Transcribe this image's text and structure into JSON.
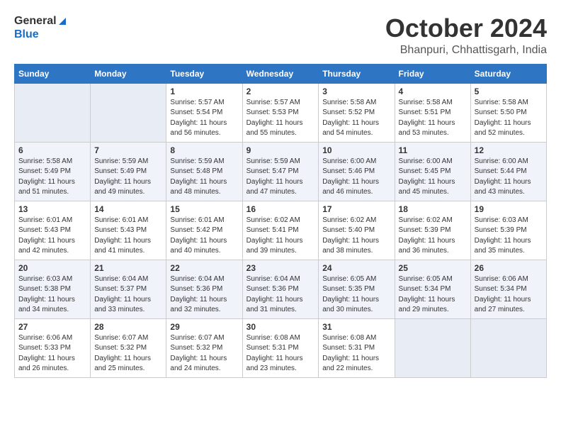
{
  "logo": {
    "general": "General",
    "blue": "Blue"
  },
  "title": "October 2024",
  "location": "Bhanpuri, Chhattisgarh, India",
  "days_of_week": [
    "Sunday",
    "Monday",
    "Tuesday",
    "Wednesday",
    "Thursday",
    "Friday",
    "Saturday"
  ],
  "weeks": [
    [
      {
        "day": "",
        "sunrise": "",
        "sunset": "",
        "daylight": "",
        "empty": true
      },
      {
        "day": "",
        "sunrise": "",
        "sunset": "",
        "daylight": "",
        "empty": true
      },
      {
        "day": "1",
        "sunrise": "Sunrise: 5:57 AM",
        "sunset": "Sunset: 5:54 PM",
        "daylight": "Daylight: 11 hours and 56 minutes.",
        "empty": false
      },
      {
        "day": "2",
        "sunrise": "Sunrise: 5:57 AM",
        "sunset": "Sunset: 5:53 PM",
        "daylight": "Daylight: 11 hours and 55 minutes.",
        "empty": false
      },
      {
        "day": "3",
        "sunrise": "Sunrise: 5:58 AM",
        "sunset": "Sunset: 5:52 PM",
        "daylight": "Daylight: 11 hours and 54 minutes.",
        "empty": false
      },
      {
        "day": "4",
        "sunrise": "Sunrise: 5:58 AM",
        "sunset": "Sunset: 5:51 PM",
        "daylight": "Daylight: 11 hours and 53 minutes.",
        "empty": false
      },
      {
        "day": "5",
        "sunrise": "Sunrise: 5:58 AM",
        "sunset": "Sunset: 5:50 PM",
        "daylight": "Daylight: 11 hours and 52 minutes.",
        "empty": false
      }
    ],
    [
      {
        "day": "6",
        "sunrise": "Sunrise: 5:58 AM",
        "sunset": "Sunset: 5:49 PM",
        "daylight": "Daylight: 11 hours and 51 minutes.",
        "empty": false
      },
      {
        "day": "7",
        "sunrise": "Sunrise: 5:59 AM",
        "sunset": "Sunset: 5:49 PM",
        "daylight": "Daylight: 11 hours and 49 minutes.",
        "empty": false
      },
      {
        "day": "8",
        "sunrise": "Sunrise: 5:59 AM",
        "sunset": "Sunset: 5:48 PM",
        "daylight": "Daylight: 11 hours and 48 minutes.",
        "empty": false
      },
      {
        "day": "9",
        "sunrise": "Sunrise: 5:59 AM",
        "sunset": "Sunset: 5:47 PM",
        "daylight": "Daylight: 11 hours and 47 minutes.",
        "empty": false
      },
      {
        "day": "10",
        "sunrise": "Sunrise: 6:00 AM",
        "sunset": "Sunset: 5:46 PM",
        "daylight": "Daylight: 11 hours and 46 minutes.",
        "empty": false
      },
      {
        "day": "11",
        "sunrise": "Sunrise: 6:00 AM",
        "sunset": "Sunset: 5:45 PM",
        "daylight": "Daylight: 11 hours and 45 minutes.",
        "empty": false
      },
      {
        "day": "12",
        "sunrise": "Sunrise: 6:00 AM",
        "sunset": "Sunset: 5:44 PM",
        "daylight": "Daylight: 11 hours and 43 minutes.",
        "empty": false
      }
    ],
    [
      {
        "day": "13",
        "sunrise": "Sunrise: 6:01 AM",
        "sunset": "Sunset: 5:43 PM",
        "daylight": "Daylight: 11 hours and 42 minutes.",
        "empty": false
      },
      {
        "day": "14",
        "sunrise": "Sunrise: 6:01 AM",
        "sunset": "Sunset: 5:43 PM",
        "daylight": "Daylight: 11 hours and 41 minutes.",
        "empty": false
      },
      {
        "day": "15",
        "sunrise": "Sunrise: 6:01 AM",
        "sunset": "Sunset: 5:42 PM",
        "daylight": "Daylight: 11 hours and 40 minutes.",
        "empty": false
      },
      {
        "day": "16",
        "sunrise": "Sunrise: 6:02 AM",
        "sunset": "Sunset: 5:41 PM",
        "daylight": "Daylight: 11 hours and 39 minutes.",
        "empty": false
      },
      {
        "day": "17",
        "sunrise": "Sunrise: 6:02 AM",
        "sunset": "Sunset: 5:40 PM",
        "daylight": "Daylight: 11 hours and 38 minutes.",
        "empty": false
      },
      {
        "day": "18",
        "sunrise": "Sunrise: 6:02 AM",
        "sunset": "Sunset: 5:39 PM",
        "daylight": "Daylight: 11 hours and 36 minutes.",
        "empty": false
      },
      {
        "day": "19",
        "sunrise": "Sunrise: 6:03 AM",
        "sunset": "Sunset: 5:39 PM",
        "daylight": "Daylight: 11 hours and 35 minutes.",
        "empty": false
      }
    ],
    [
      {
        "day": "20",
        "sunrise": "Sunrise: 6:03 AM",
        "sunset": "Sunset: 5:38 PM",
        "daylight": "Daylight: 11 hours and 34 minutes.",
        "empty": false
      },
      {
        "day": "21",
        "sunrise": "Sunrise: 6:04 AM",
        "sunset": "Sunset: 5:37 PM",
        "daylight": "Daylight: 11 hours and 33 minutes.",
        "empty": false
      },
      {
        "day": "22",
        "sunrise": "Sunrise: 6:04 AM",
        "sunset": "Sunset: 5:36 PM",
        "daylight": "Daylight: 11 hours and 32 minutes.",
        "empty": false
      },
      {
        "day": "23",
        "sunrise": "Sunrise: 6:04 AM",
        "sunset": "Sunset: 5:36 PM",
        "daylight": "Daylight: 11 hours and 31 minutes.",
        "empty": false
      },
      {
        "day": "24",
        "sunrise": "Sunrise: 6:05 AM",
        "sunset": "Sunset: 5:35 PM",
        "daylight": "Daylight: 11 hours and 30 minutes.",
        "empty": false
      },
      {
        "day": "25",
        "sunrise": "Sunrise: 6:05 AM",
        "sunset": "Sunset: 5:34 PM",
        "daylight": "Daylight: 11 hours and 29 minutes.",
        "empty": false
      },
      {
        "day": "26",
        "sunrise": "Sunrise: 6:06 AM",
        "sunset": "Sunset: 5:34 PM",
        "daylight": "Daylight: 11 hours and 27 minutes.",
        "empty": false
      }
    ],
    [
      {
        "day": "27",
        "sunrise": "Sunrise: 6:06 AM",
        "sunset": "Sunset: 5:33 PM",
        "daylight": "Daylight: 11 hours and 26 minutes.",
        "empty": false
      },
      {
        "day": "28",
        "sunrise": "Sunrise: 6:07 AM",
        "sunset": "Sunset: 5:32 PM",
        "daylight": "Daylight: 11 hours and 25 minutes.",
        "empty": false
      },
      {
        "day": "29",
        "sunrise": "Sunrise: 6:07 AM",
        "sunset": "Sunset: 5:32 PM",
        "daylight": "Daylight: 11 hours and 24 minutes.",
        "empty": false
      },
      {
        "day": "30",
        "sunrise": "Sunrise: 6:08 AM",
        "sunset": "Sunset: 5:31 PM",
        "daylight": "Daylight: 11 hours and 23 minutes.",
        "empty": false
      },
      {
        "day": "31",
        "sunrise": "Sunrise: 6:08 AM",
        "sunset": "Sunset: 5:31 PM",
        "daylight": "Daylight: 11 hours and 22 minutes.",
        "empty": false
      },
      {
        "day": "",
        "sunrise": "",
        "sunset": "",
        "daylight": "",
        "empty": true
      },
      {
        "day": "",
        "sunrise": "",
        "sunset": "",
        "daylight": "",
        "empty": true
      }
    ]
  ]
}
